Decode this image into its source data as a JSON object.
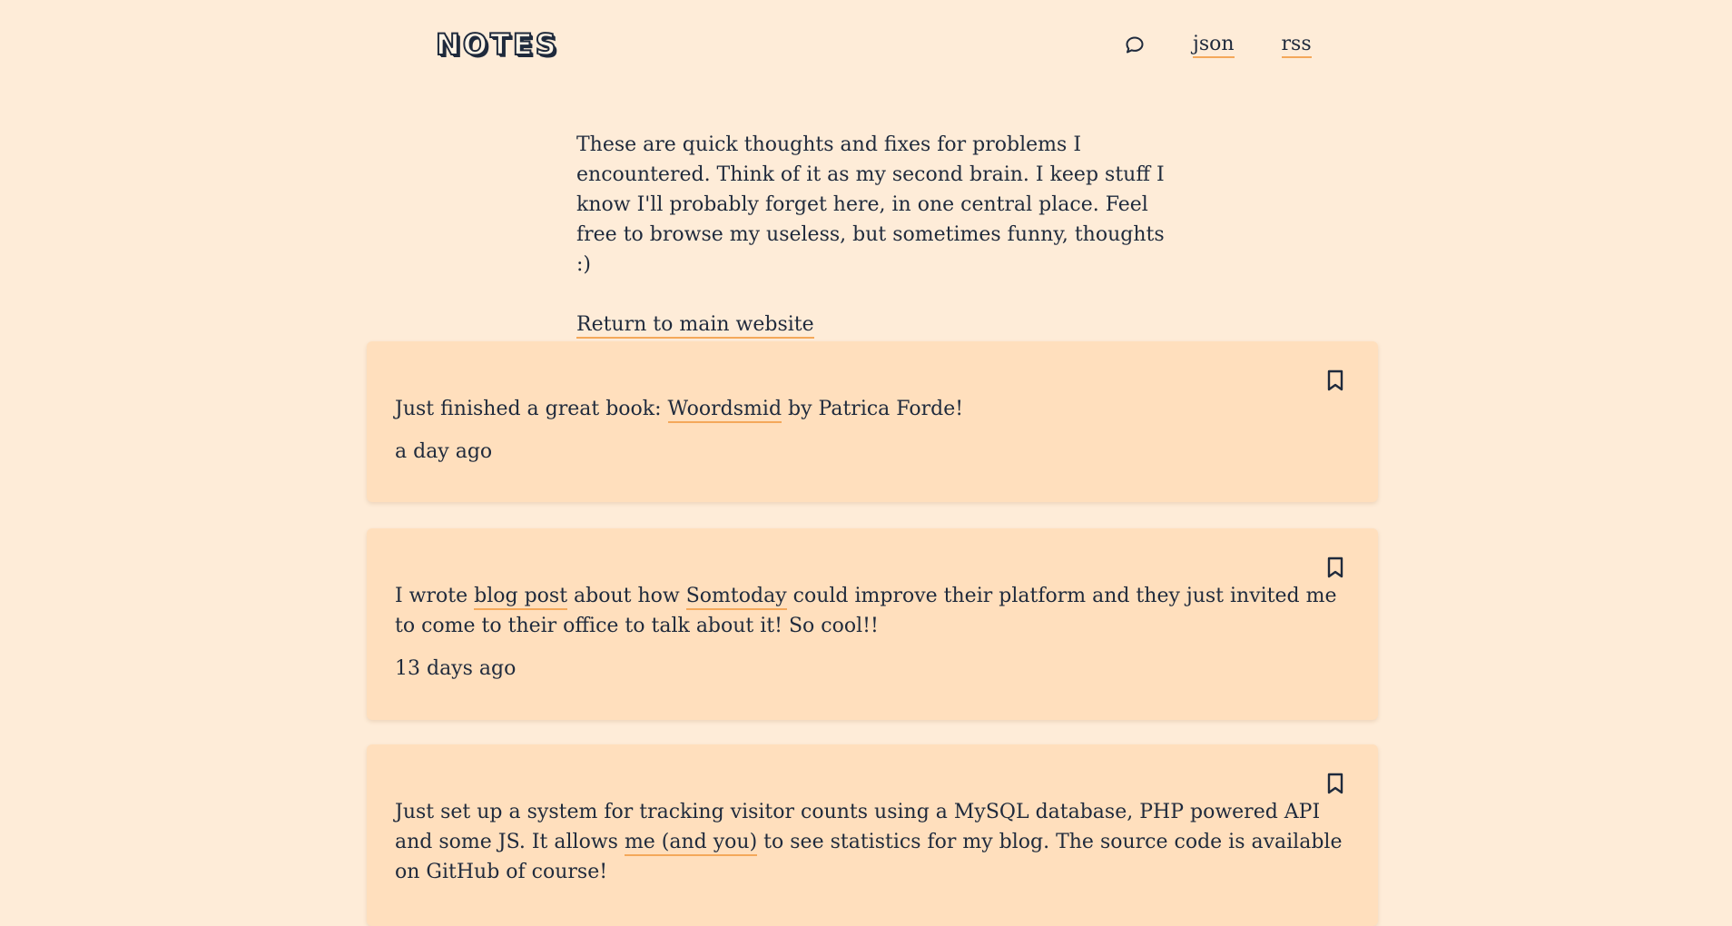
{
  "header": {
    "logo": "NOTES",
    "nav": {
      "json_label": "json",
      "rss_label": "rss"
    }
  },
  "intro": {
    "text": "These are quick thoughts and fixes for problems I encountered. Think of it as my second brain. I keep stuff I know I'll probably forget here, in one central place. Feel free to browse my useless, but sometimes funny, thoughts :)",
    "return_link": "Return to main website"
  },
  "notes": [
    {
      "parts": [
        "Just finished a great book: ",
        "Woordsmid",
        " by Patrica Forde!"
      ],
      "time": "a day ago"
    },
    {
      "parts": [
        "I wrote ",
        "blog post",
        " about how ",
        "Somtoday",
        " could improve their platform and they just invited me to come to their office to talk about it! So cool!!"
      ],
      "time": "13 days ago"
    },
    {
      "parts": [
        "Just set up a system for tracking visitor counts using a MySQL database, PHP powered API and some JS. It allows ",
        "me (and you)",
        " to see statistics for my blog. The source code is available on GitHub of course!"
      ],
      "time": ""
    }
  ],
  "icons": {
    "search": "search-icon",
    "bookmark": "bookmark-icon"
  },
  "colors": {
    "background": "#feecd8",
    "card": "#ffdfbd",
    "text": "#1f2a3c",
    "link_underline": "#f4a85a"
  }
}
